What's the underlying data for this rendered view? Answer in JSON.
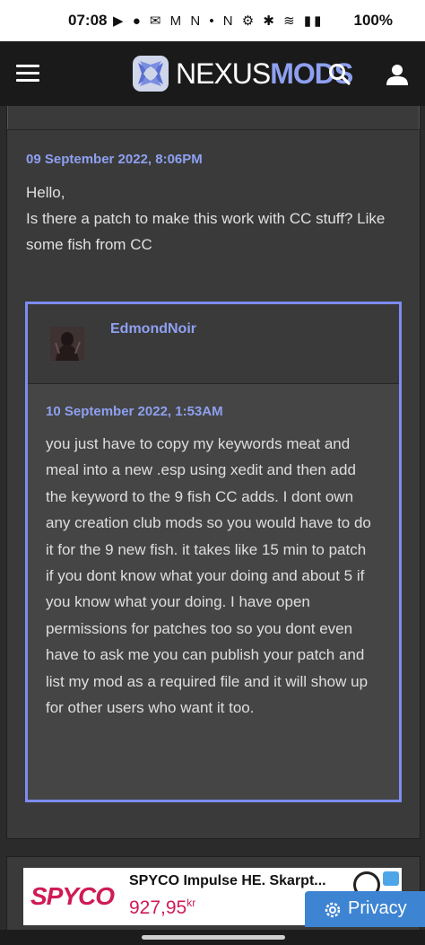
{
  "status_bar": {
    "time": "07:08",
    "icons": "▶ ● ✉ M N • N ⚙ ✱ ≋ ▮▮",
    "battery": "100%"
  },
  "header": {
    "brand_nexus": "NEXUS",
    "brand_mods": "MODS",
    "menu_icon": "hamburger-icon",
    "search_icon": "search-icon",
    "user_icon": "user-icon"
  },
  "post": {
    "date": "09 September 2022, 8:06PM",
    "text": "Hello,\nIs there a patch to make this work with CC stuff? Like some fish from CC"
  },
  "reply": {
    "author": "EdmondNoir",
    "date": "10 September 2022, 1:53AM",
    "text": "you just have to copy my keywords meat and meal into a new .esp using xedit and then add the keyword to the 9 fish CC adds. I dont own any creation club mods so you would have to do it for the 9 new fish. it takes like 15 min to patch if you dont know what your doing and about 5 if you know what your doing. I have open permissions for patches too so you dont even have to ask me you can publish your patch and list my mod as a required file and it will show up for other users who want it too."
  },
  "ad": {
    "brand": "SPYCO",
    "title": "SPYCO Impulse HE. Skarpt...",
    "price": "927,95",
    "currency": "kr"
  },
  "privacy": {
    "label": "Privacy"
  },
  "colors": {
    "accent": "#8ea0f0",
    "quote_border": "#7c8cf0",
    "header_bg": "#1a1a1a",
    "privacy_bg": "#3d84d2"
  }
}
